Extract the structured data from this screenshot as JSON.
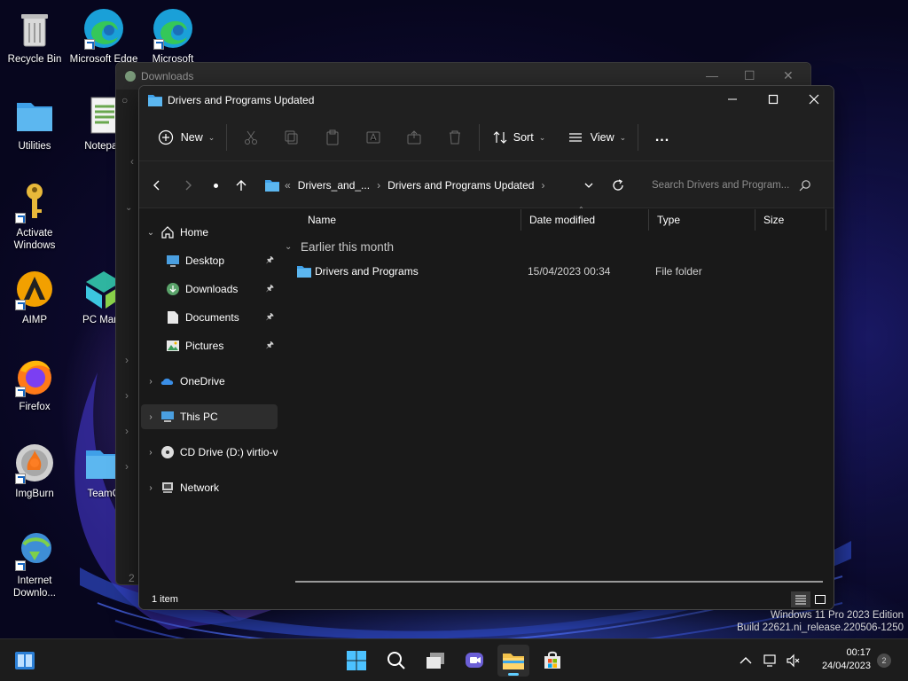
{
  "desktop": {
    "icons": [
      {
        "label": "Recycle Bin",
        "icon": "recycle-bin-icon"
      },
      {
        "label": "Microsoft Edge",
        "icon": "edge-icon"
      },
      {
        "label": "Microsoft",
        "icon": "edge-icon"
      },
      {
        "label": "Utilities",
        "icon": "folder-icon"
      },
      {
        "label": "Notepad",
        "icon": "notepad-icon"
      },
      {
        "label": "Activate Windows",
        "icon": "key-icon"
      },
      {
        "label": "AIMP",
        "icon": "aimp-icon"
      },
      {
        "label": "PC Mana",
        "icon": "pc-manager-icon"
      },
      {
        "label": "Firefox",
        "icon": "firefox-icon"
      },
      {
        "label": "ImgBurn",
        "icon": "imgburn-icon"
      },
      {
        "label": "TeamO",
        "icon": "folder-icon"
      },
      {
        "label": "Internet Downlo...",
        "icon": "idm-icon"
      }
    ]
  },
  "background_window": {
    "title": "Downloads",
    "status_fragment": "2"
  },
  "window": {
    "title": "Drivers and Programs Updated",
    "controls": {
      "minimize": "minimize",
      "maximize": "maximize",
      "close": "close"
    }
  },
  "toolbar": {
    "new_label": "New",
    "sort_label": "Sort",
    "view_label": "View",
    "more_label": "..."
  },
  "address": {
    "overflow": "«",
    "crumbs": [
      "Drivers_and_...",
      "Drivers and Programs Updated"
    ],
    "search_placeholder": "Search Drivers and Program..."
  },
  "navpane": {
    "items": [
      {
        "label": "Home",
        "icon": "home-icon",
        "expandable": true,
        "expanded": true
      },
      {
        "label": "Desktop",
        "icon": "desktop-icon",
        "pinned": true
      },
      {
        "label": "Downloads",
        "icon": "downloads-icon",
        "pinned": true
      },
      {
        "label": "Documents",
        "icon": "documents-icon",
        "pinned": true
      },
      {
        "label": "Pictures",
        "icon": "pictures-icon",
        "pinned": true
      },
      {
        "label": "OneDrive",
        "icon": "onedrive-icon",
        "expandable": true
      },
      {
        "label": "This PC",
        "icon": "this-pc-icon",
        "expandable": true,
        "selected": true
      },
      {
        "label": "CD Drive (D:) virtio-v",
        "icon": "cd-drive-icon",
        "expandable": true
      },
      {
        "label": "Network",
        "icon": "network-icon",
        "expandable": true
      }
    ]
  },
  "filelist": {
    "columns": [
      "Name",
      "Date modified",
      "Type",
      "Size"
    ],
    "group": "Earlier this month",
    "rows": [
      {
        "name": "Drivers and Programs",
        "date": "15/04/2023 00:34",
        "type": "File folder",
        "size": ""
      }
    ]
  },
  "status": {
    "item_count": "1 item"
  },
  "watermark": {
    "line1": "Windows 11 Pro 2023 Edition",
    "line2": "Build 22621.ni_release.220506-1250"
  },
  "taskbar": {
    "time": "00:17",
    "date": "24/04/2023",
    "notifications": "2"
  },
  "colors": {
    "accent": "#60cdff",
    "folder": "#f3c24b",
    "window_bg": "#191919"
  }
}
